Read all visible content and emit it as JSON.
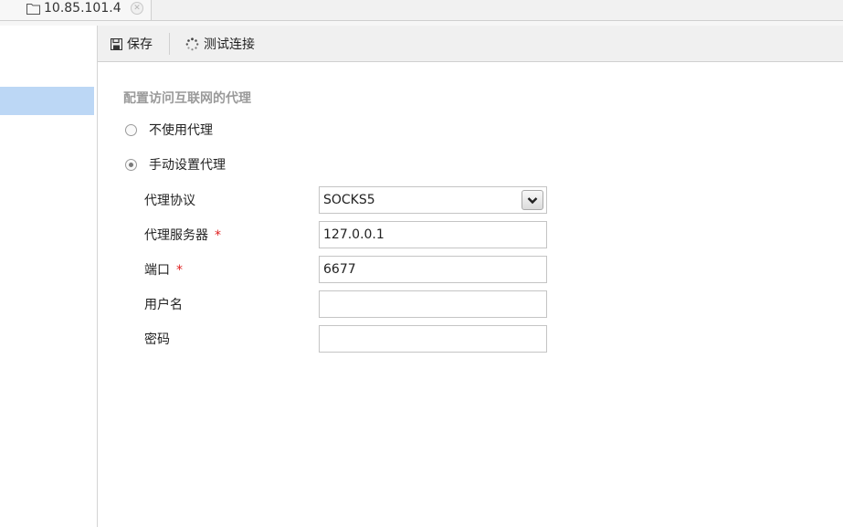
{
  "tab": {
    "label": "10.85.101.4",
    "close_glyph": "✕",
    "icon": "folder-icon"
  },
  "toolbar": {
    "save_label": "保存",
    "save_icon": "floppy-disk-icon",
    "test_label": "测试连接",
    "test_icon": "loading-spinner-icon"
  },
  "section": {
    "title": "配置访问互联网的代理"
  },
  "proxy_options": [
    {
      "label": "不使用代理",
      "checked": false
    },
    {
      "label": "手动设置代理",
      "checked": true
    }
  ],
  "form": {
    "protocol": {
      "label": "代理协议",
      "value": "SOCKS5"
    },
    "server": {
      "label": "代理服务器",
      "required_mark": "*",
      "value": "127.0.0.1"
    },
    "port": {
      "label": "端口",
      "required_mark": "*",
      "value": "6677"
    },
    "username": {
      "label": "用户名",
      "value": ""
    },
    "password": {
      "label": "密码",
      "value": ""
    }
  },
  "colors": {
    "selection": "#bcd7f5",
    "required": "#e02020",
    "section_title": "#9a9a9a"
  }
}
